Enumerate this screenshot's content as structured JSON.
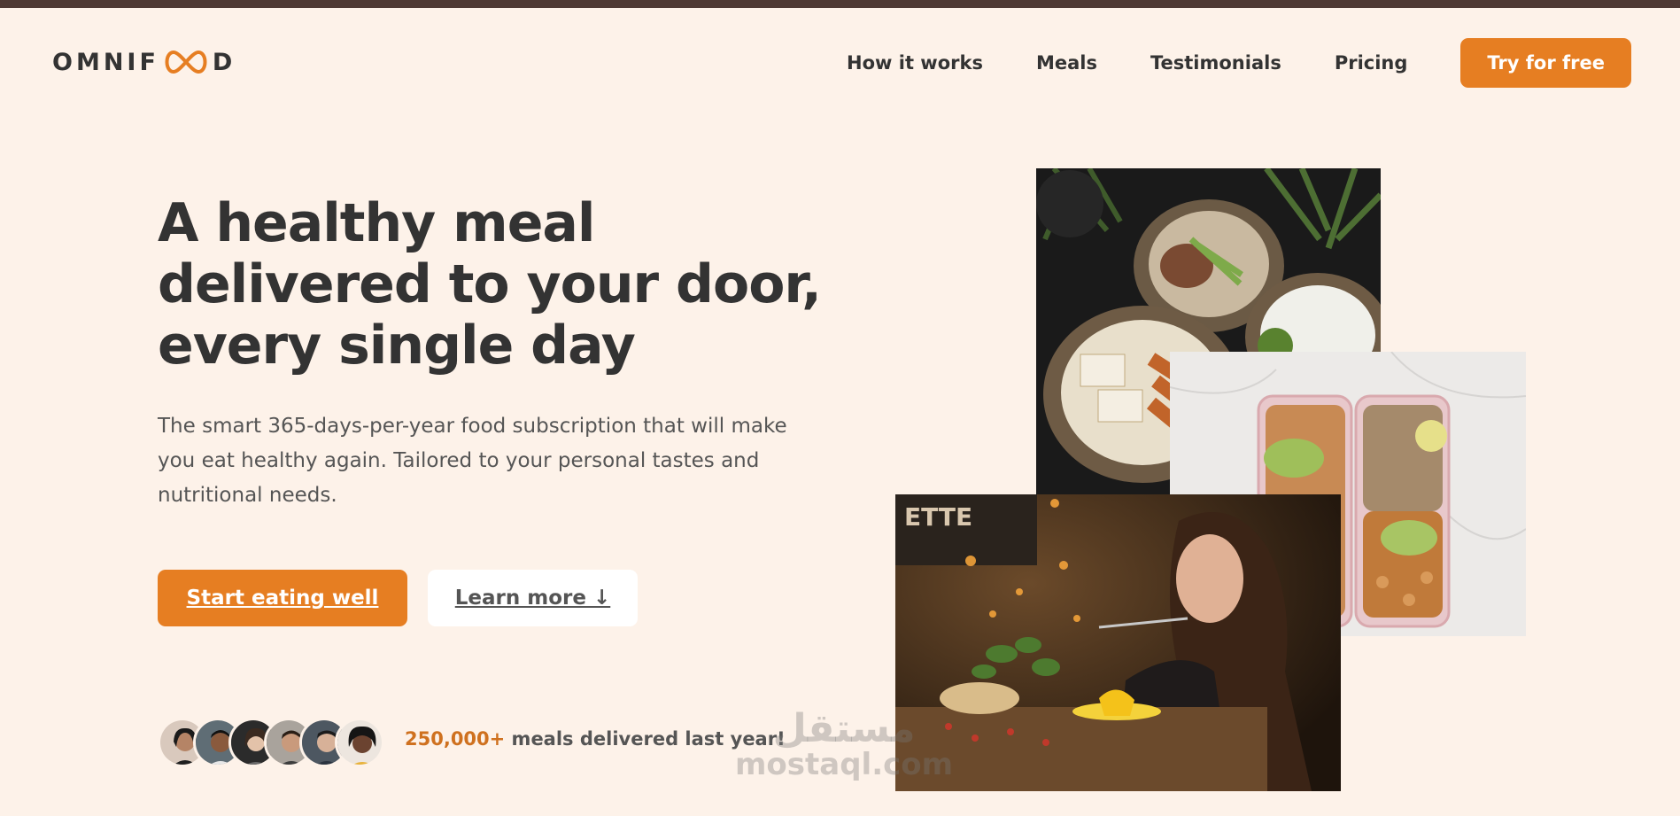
{
  "brand": {
    "logo_left": "OMNIF",
    "logo_right": "D",
    "accent": "#e67e22",
    "topbar_color": "#4f3934",
    "background": "#fdf2e9"
  },
  "nav": {
    "items": [
      "How it works",
      "Meals",
      "Testimonials",
      "Pricing"
    ],
    "cta": "Try for free"
  },
  "hero": {
    "title": "A healthy meal delivered to your door, every single day",
    "description": "The smart 365-days-per-year food subscription that will make you eat healthy again. Tailored to your personal tastes and nutritional needs.",
    "primary_button": "Start eating well",
    "secondary_button": "Learn more ↓",
    "delivered_count": "250,000+",
    "delivered_text": " meals delivered last year!"
  },
  "watermark": {
    "arabic": "مستقل",
    "latin": "mostaql.com"
  }
}
